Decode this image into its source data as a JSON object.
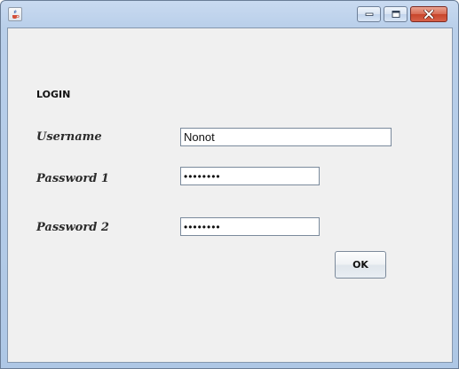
{
  "window": {
    "title": "",
    "icon": "java-cup-icon",
    "controls": [
      "minimize-icon",
      "maximize-icon",
      "close-icon"
    ]
  },
  "form": {
    "heading": "LOGIN",
    "username_label": "Username",
    "username_value": "Nonot",
    "password1_label": "Password 1",
    "password1_value": "••••••••",
    "password2_label": "Password 2",
    "password2_value": "••••••••",
    "ok_label": "OK"
  }
}
